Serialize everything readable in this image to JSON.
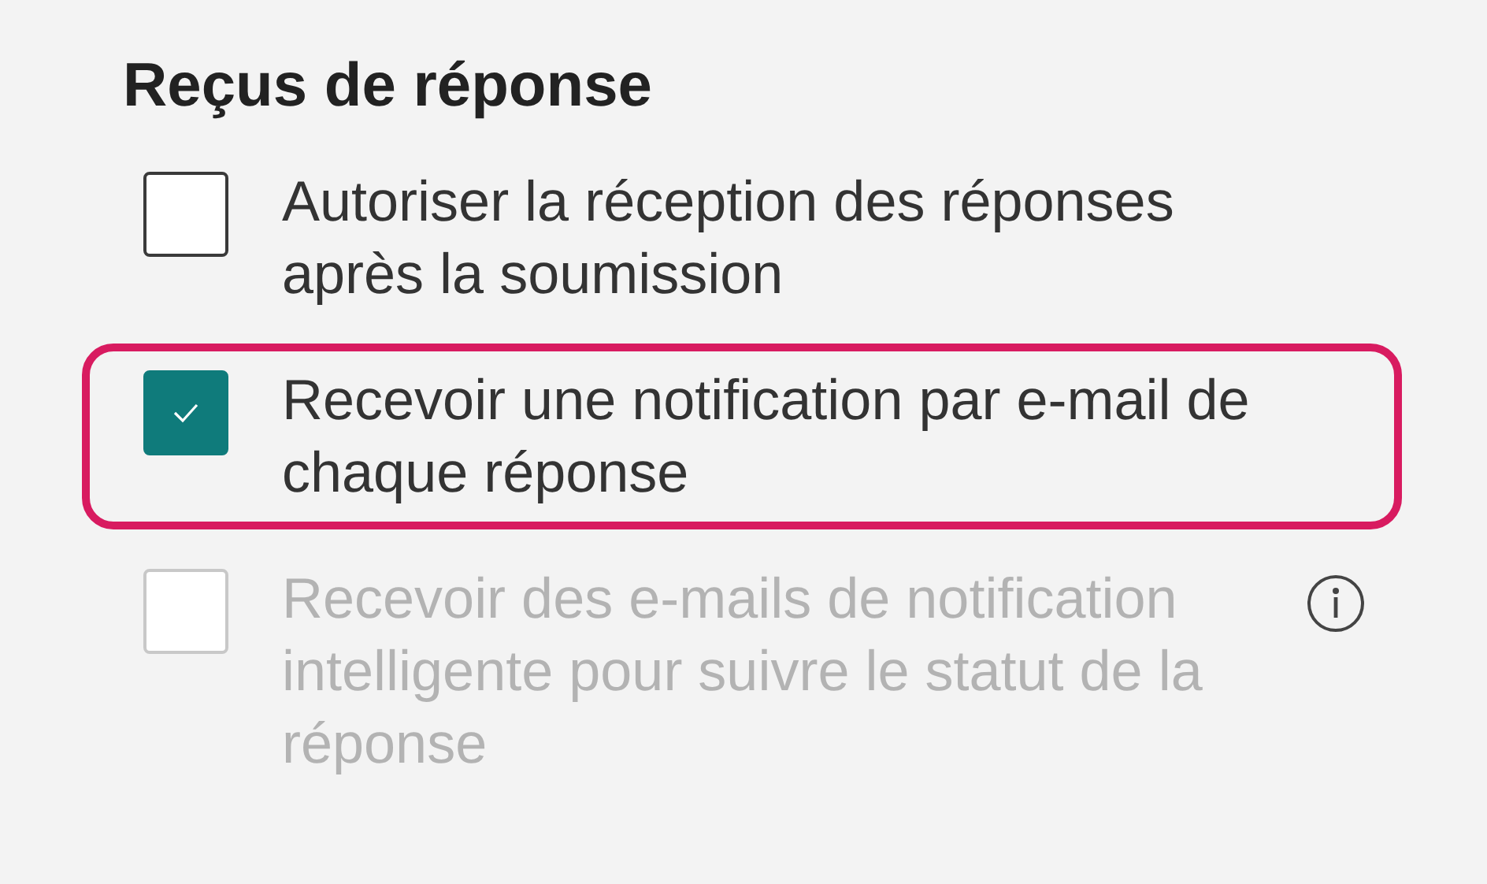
{
  "section": {
    "title": "Reçus de réponse"
  },
  "options": [
    {
      "label": "Autoriser la réception des réponses après la soumission",
      "checked": false,
      "disabled": false,
      "highlighted": false,
      "info": false
    },
    {
      "label": "Recevoir une notification par e-mail de chaque réponse",
      "checked": true,
      "disabled": false,
      "highlighted": true,
      "info": false
    },
    {
      "label": "Recevoir des e-mails de notification intelligente pour suivre le statut de la réponse",
      "checked": false,
      "disabled": true,
      "highlighted": false,
      "info": true
    }
  ]
}
